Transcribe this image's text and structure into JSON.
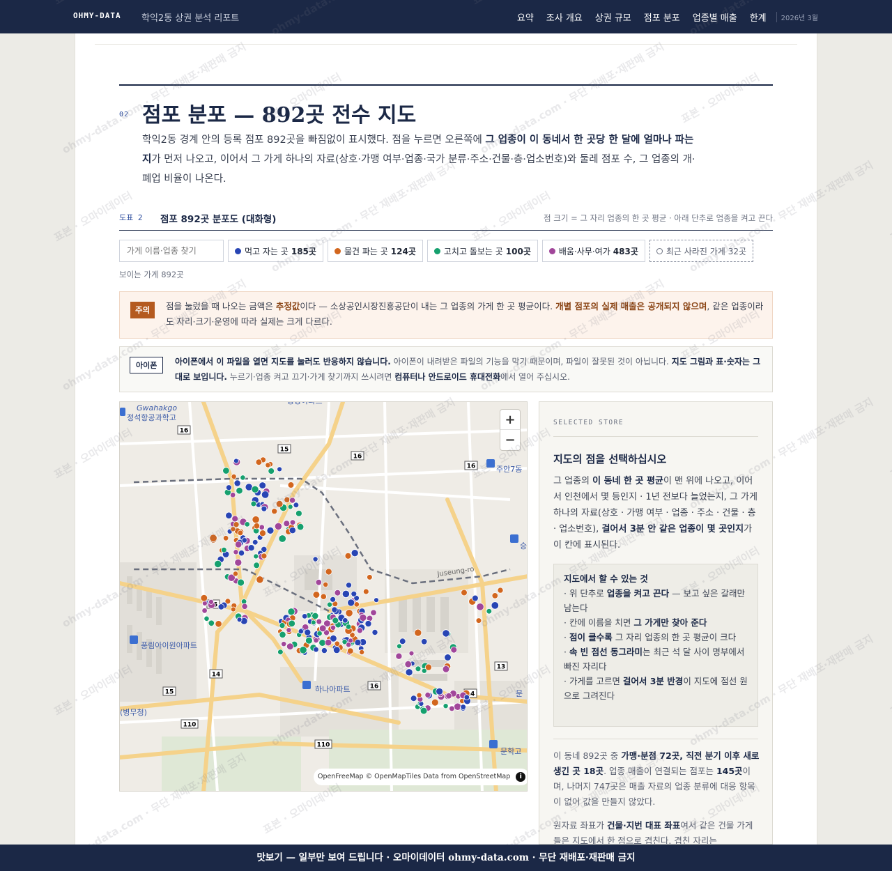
{
  "header": {
    "brand": "OHMY-DATA",
    "report_title": "학익2동 상권 분석 리포트",
    "nav": [
      "요약",
      "조사 개요",
      "상권 규모",
      "점포 분포",
      "업종별 매출",
      "한계"
    ],
    "date": "2026년 3월"
  },
  "section": {
    "number": "02",
    "title": "점포 분포 — 892곳 전수 지도",
    "lead_1": "학익2동 경계 안의 등록 점포 892곳을 빠짐없이 표시했다. 점을 누르면 오른쪽에 ",
    "lead_bold": "그 업종이 이 동네서 한 곳당 한 달에 얼마나 파는지",
    "lead_2": "가 먼저 나오고, 이어서 그 가게 하나의 자료(상호·가맹 여부·업종·국가 분류·주소·건물·층·업소번호)와 둘레 점포 수, 그 업종의 개·폐업 비율이 나온다."
  },
  "figure": {
    "label": "도표 2",
    "title": "점포 892곳 분포도 (대화형)",
    "note": "점 크기 = 그 자리 업종의 한 곳 평균 · 아래 단추로 업종을 켜고 끈다"
  },
  "controls": {
    "search_placeholder": "가게 이름·업종 찾기",
    "filters": [
      {
        "label": "먹고 자는 곳",
        "count": "185곳",
        "color": "#2845b4"
      },
      {
        "label": "물건 파는 곳",
        "count": "124곳",
        "color": "#d2661e"
      },
      {
        "label": "고치고 돌보는 곳",
        "count": "100곳",
        "color": "#16a06e"
      },
      {
        "label": "배움·사무·여가",
        "count": "483곳",
        "color": "#a1469a"
      }
    ],
    "closed_filter": {
      "label": "최근 사라진 가게",
      "count": "32곳"
    },
    "visible_count": "보이는 가게 892곳"
  },
  "warning": {
    "tag": "주의",
    "t1": "점을 눌렀을 때 나오는 금액은 ",
    "b1": "추정값",
    "t2": "이다 — 소상공인시장진흥공단이 내는 그 업종의 가게 한 곳 평균이다. ",
    "b2": "개별 점포의 실제 매출은 공개되지 않으며",
    "t3": ", 같은 업종이라도 자리·크기·운영에 따라 실제는 크게 다르다."
  },
  "iphone": {
    "tag": "아이폰",
    "b1": "아이폰에서 이 파일을 열면 지도를 눌러도 반응하지 않습니다.",
    "t1": " 아이폰이 내려받은 파일의 기능을 막기 때문이며, 파일이 잘못된 것이 아닙니다. ",
    "b2": "지도 그림과 표·숫자는 그대로 보입니다.",
    "t2": " 누르기·업종 켜고 끄기·가게 찾기까지 쓰시려면 ",
    "b3": "컴퓨터나 안드로이드 휴대전화",
    "t3": "에서 열어 주십시오."
  },
  "map": {
    "labels": {
      "gwahakgo": "Gwahakgo",
      "school": "정석항공과학고",
      "apt1": "풍림아이원아파트",
      "apt2": "하나아파트",
      "road": "Juseung-ro",
      "munhak": "문학고",
      "jugan": "주안7동",
      "top": "동양아파트",
      "byeongmu": "(병무청)",
      "right_edge1": "문",
      "right_edge2": "승"
    },
    "road_numbers": [
      "16",
      "15",
      "16",
      "16",
      "15",
      "14",
      "15",
      "16",
      "14",
      "13",
      "110",
      "110"
    ],
    "zoom_in": "+",
    "zoom_out": "−",
    "attribution": "OpenFreeMap © OpenMapTiles Data from OpenStreetMap",
    "info": "i"
  },
  "side": {
    "kicker": "SELECTED STORE",
    "title": "지도의 점을 선택하십시오",
    "p_t1": "그 업종의 ",
    "p_b1": "이 동네 한 곳 평균",
    "p_t2": "이 맨 위에 나오고, 이어서 인천에서 몇 등인지 · 1년 전보다 늘었는지, 그 가게 하나의 자료(상호 · 가맹 여부 · 업종 · 주소 · 건물 · 층 · 업소번호), ",
    "p_b2": "걸어서 3분 안 같은 업종이 몇 곳인지",
    "p_t3": "가 이 칸에 표시된다.",
    "howto_title": "지도에서 할 수 있는 것",
    "howto": [
      {
        "pre": "· 위 단추로 ",
        "bold": "업종을 켜고 끈다",
        "post": " — 보고 싶은 갈래만 남는다"
      },
      {
        "pre": "· 칸에 이름을 치면 ",
        "bold": "그 가게만 찾아 준다",
        "post": ""
      },
      {
        "pre": "· ",
        "bold": "점이 클수록",
        "post": " 그 자리 업종의 한 곳 평균이 크다"
      },
      {
        "pre": "· ",
        "bold": "속 빈 점선 동그라미",
        "post": "는 최근 석 달 사이 명부에서 빠진 자리다"
      },
      {
        "pre": "· 가게를 고르면 ",
        "bold": "걸어서 3분 반경",
        "post": "이 지도에 점선 원으로 그려진다"
      }
    ],
    "p2_t1": "이 동네 892곳 중 ",
    "p2_b1": "가맹·분점 72곳, 직전 분기 이후 새로 생긴 곳 18곳",
    "p2_t2": ". 업종 매출이 연결되는 점포는 ",
    "p2_b2": "145곳",
    "p2_t3": "이며, 나머지 747곳은 매출 자료의 업종 분류에 대응 항목이 없어 값을 만들지 않았다.",
    "p3_t1": "원자료 좌표가 ",
    "p3_b1": "건물·지번 대표 좌표",
    "p3_t2": "여서 같은 건물 가게들은 지도에서 한 점으로 겹친다. 겹친 자리는"
  },
  "watermark": [
    "표본 · 오마이데이터",
    "ohmy-data.com · 무단 재배포·재판매 금지"
  ],
  "footer": "맛보기 — 일부만 보여 드립니다 · 오마이데이터 ohmy-data.com · 무단 재배포·재판매 금지"
}
